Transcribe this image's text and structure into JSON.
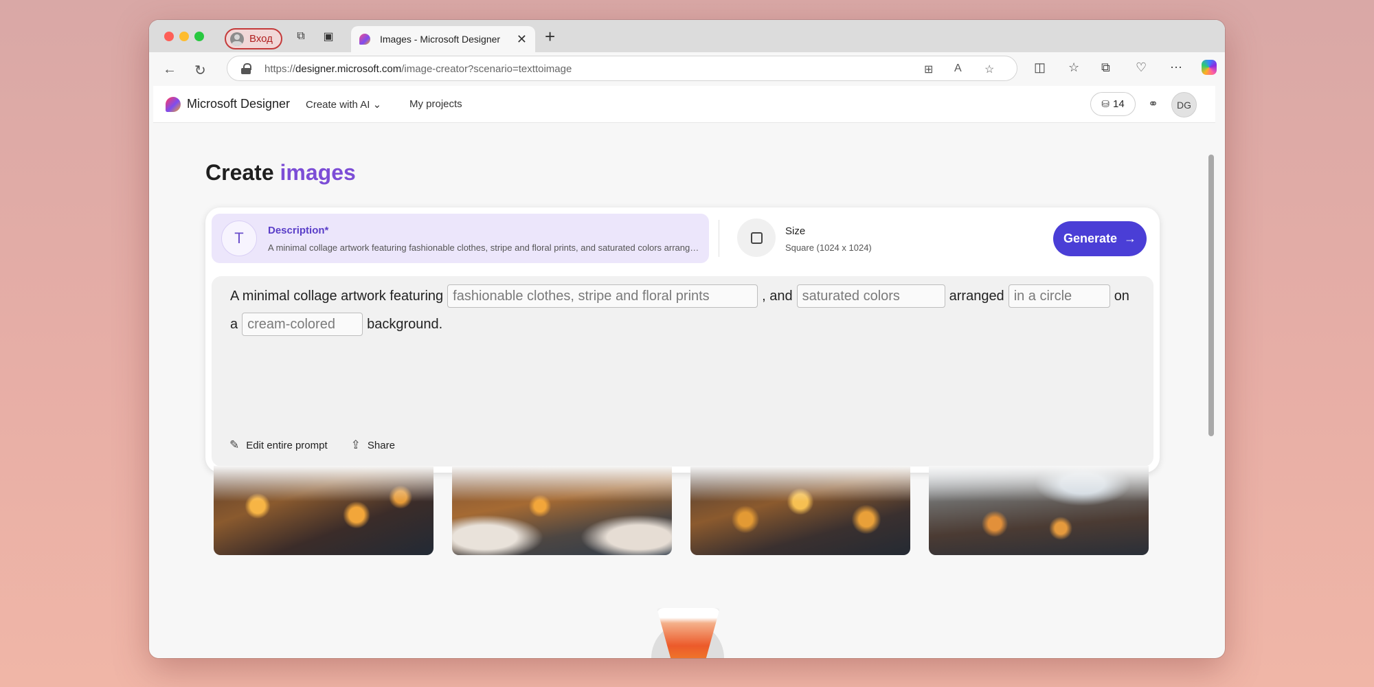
{
  "browser": {
    "profile_label": "Вход",
    "tab_title": "Images - Microsoft Designer",
    "url_scheme": "https://",
    "url_host": "designer.microsoft.com",
    "url_path": "/image-creator?scenario=texttoimage"
  },
  "header": {
    "brand": "Microsoft Designer",
    "menu_create": "Create with AI",
    "menu_projects": "My projects",
    "credits": "14",
    "avatar_initials": "DG"
  },
  "heading": {
    "prefix": "Create",
    "accent": "images"
  },
  "description": {
    "title": "Description*",
    "text": "A minimal collage artwork featuring fashionable clothes, stripe and floral prints, and saturated colors arranged in a circle on a cream-colored background."
  },
  "size": {
    "title": "Size",
    "value": "Square (1024 x 1024)"
  },
  "generate_label": "Generate",
  "prompt": {
    "part1": "A minimal collage artwork featuring",
    "slot1": "fashionable clothes, stripe and floral prints",
    "part2": ", and",
    "slot2": "saturated colors",
    "part3": "arranged",
    "slot3": "in a circle",
    "part4": "on",
    "part5": "a",
    "slot4": "cream-colored",
    "part6": "background."
  },
  "actions": {
    "edit": "Edit entire prompt",
    "share": "Share"
  },
  "colors": {
    "accent": "#4a3ed6",
    "heading_accent": "#7c4dd6"
  }
}
